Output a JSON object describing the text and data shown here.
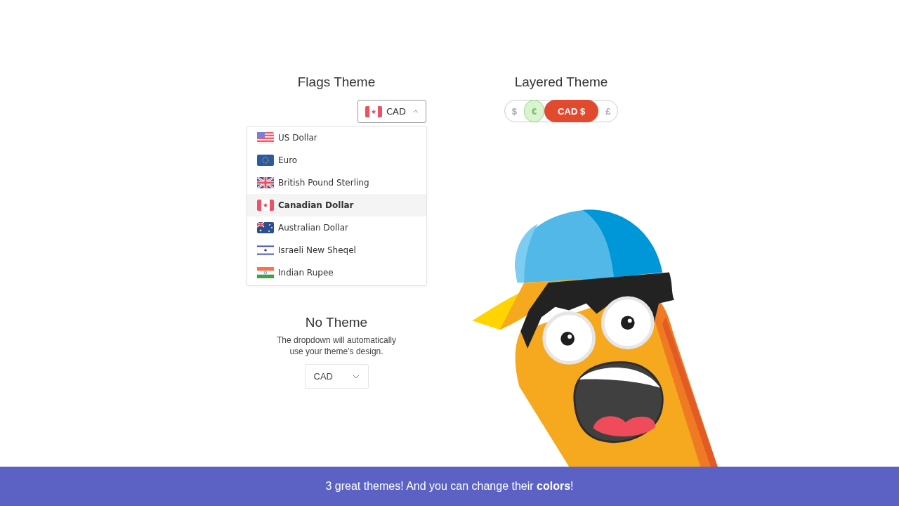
{
  "flags_theme": {
    "title": "Flags Theme",
    "button": {
      "kind": "ca",
      "label": "CAD",
      "expanded": true
    },
    "options": [
      {
        "kind": "us",
        "label": "US Dollar",
        "selected": false
      },
      {
        "kind": "eu",
        "label": "Euro",
        "selected": false
      },
      {
        "kind": "gb",
        "label": "British Pound Sterling",
        "selected": false
      },
      {
        "kind": "ca",
        "label": "Canadian Dollar",
        "selected": true
      },
      {
        "kind": "au",
        "label": "Australian Dollar",
        "selected": false
      },
      {
        "kind": "il",
        "label": "Israeli New Sheqel",
        "selected": false
      },
      {
        "kind": "in",
        "label": "Indian Rupee",
        "selected": false
      }
    ]
  },
  "layered_theme": {
    "title": "Layered Theme",
    "items": [
      {
        "label": "$",
        "selected": false,
        "highlighted": false
      },
      {
        "label": "€",
        "selected": false,
        "highlighted": true
      },
      {
        "label": "CAD $",
        "selected": true,
        "highlighted": false
      },
      {
        "label": "£",
        "selected": false,
        "highlighted": false
      }
    ]
  },
  "no_theme": {
    "title": "No Theme",
    "description": "The dropdown will automatically use your theme’s design.",
    "select": {
      "value": "CAD"
    }
  },
  "banner": {
    "text": "3 great themes! And you can change their **colors**!"
  }
}
